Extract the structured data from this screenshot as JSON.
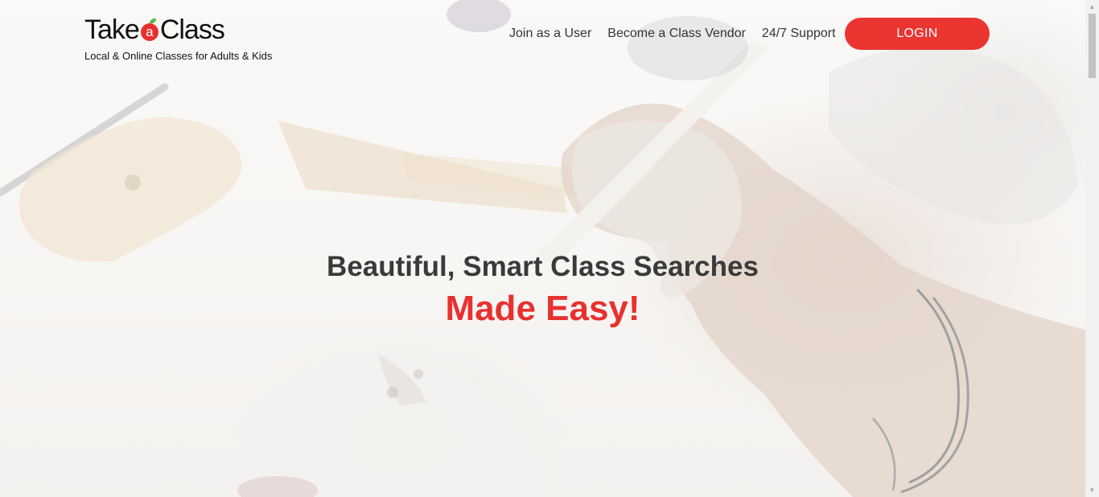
{
  "brand": {
    "name_part1": "Take",
    "name_apple_letter": "a",
    "name_part2": "Class",
    "tagline": "Local & Online Classes for Adults & Kids",
    "accent_color": "#e8312f",
    "leaf_color": "#5bb544"
  },
  "nav": {
    "items": [
      {
        "label": "Join as a User"
      },
      {
        "label": "Become a Class Vendor"
      },
      {
        "label": "24/7 Support"
      }
    ],
    "login_label": "LOGIN"
  },
  "hero": {
    "title": "Beautiful, Smart Class Searches",
    "subtitle": "Made Easy!",
    "background_image": "hand-shaping-clay-pottery-photo"
  },
  "scrollbar": {
    "up_icon": "triangle-up-icon",
    "down_icon": "triangle-down-icon"
  }
}
